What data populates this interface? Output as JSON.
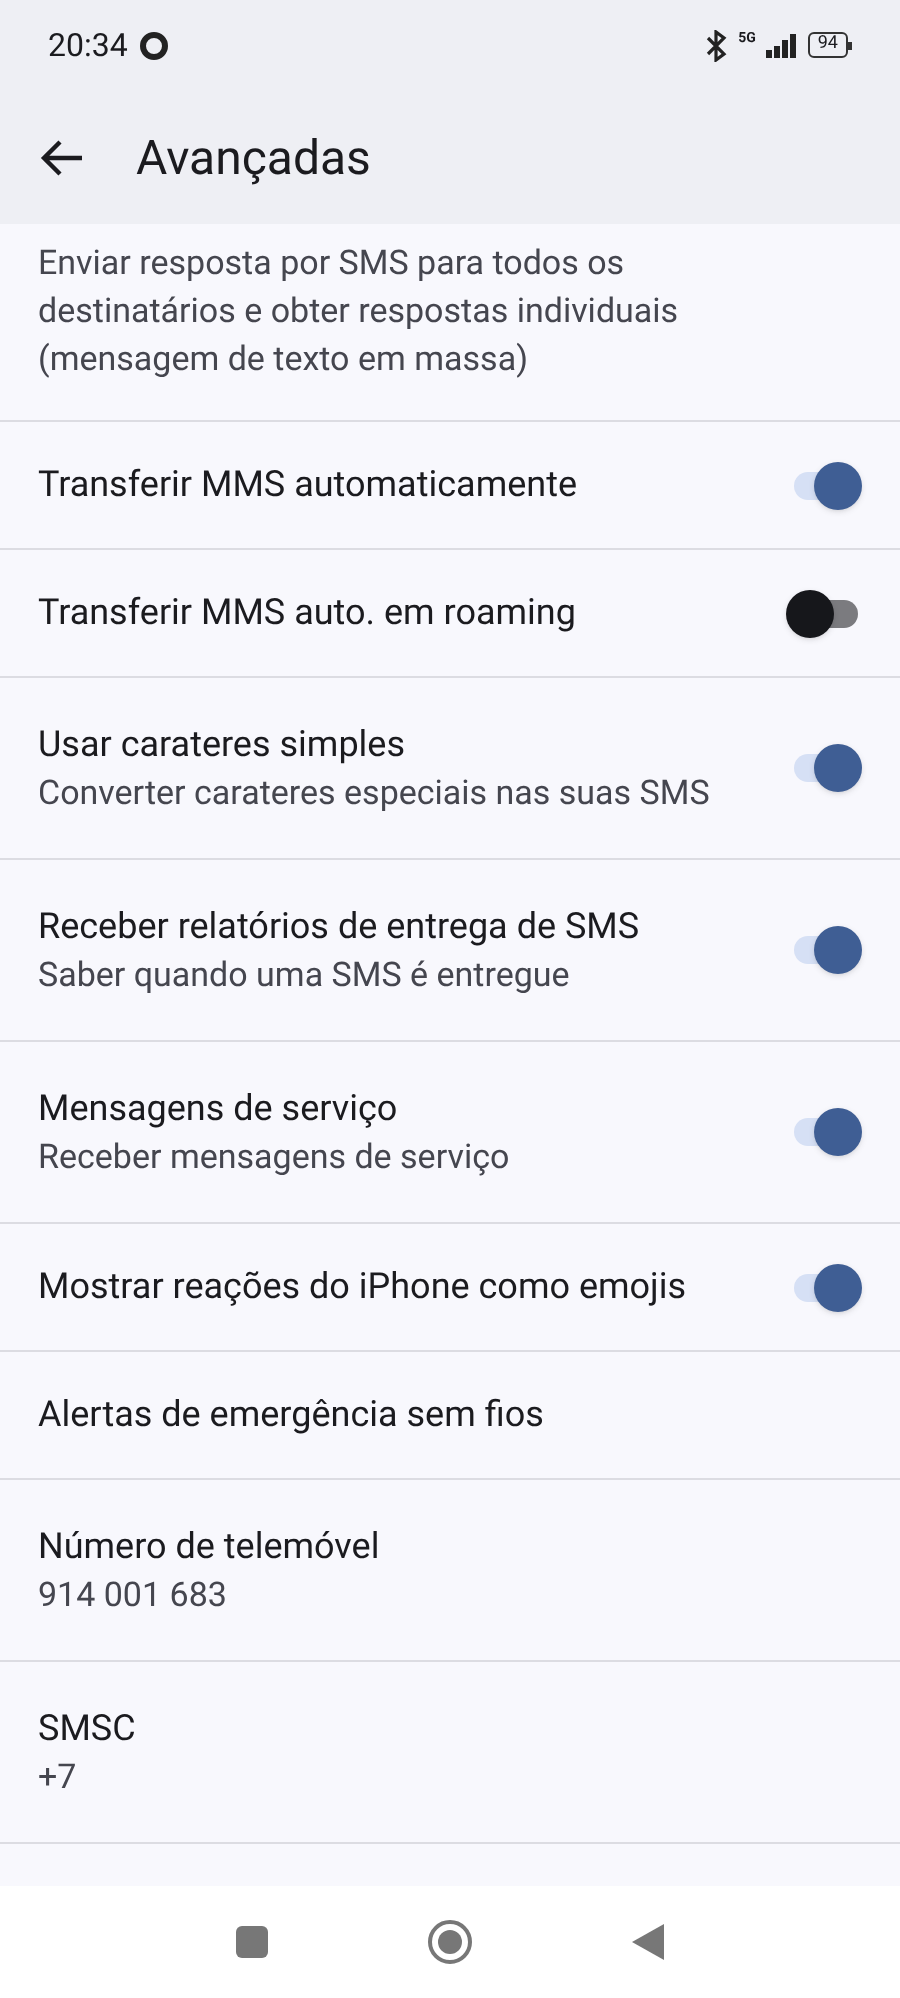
{
  "status_bar": {
    "time": "20:34",
    "network": "5G",
    "battery": "94"
  },
  "header": {
    "title": "Avançadas"
  },
  "partial_item": {
    "description": "Enviar resposta por SMS para todos os destinatários e obter respostas individuais (mensagem de texto em massa)"
  },
  "settings": [
    {
      "kind": "toggle",
      "title": "Transferir MMS automaticamente",
      "on": true
    },
    {
      "kind": "toggle",
      "title": "Transferir MMS auto. em roaming",
      "on": false
    },
    {
      "kind": "toggle",
      "title": "Usar carateres simples",
      "description": "Converter carateres especiais nas suas SMS",
      "on": true
    },
    {
      "kind": "toggle",
      "title": "Receber relatórios de entrega de SMS",
      "description": "Saber quando uma SMS é entregue",
      "on": true
    },
    {
      "kind": "toggle",
      "title": "Mensagens de serviço",
      "description": "Receber mensagens de serviço",
      "on": true
    },
    {
      "kind": "toggle",
      "title": "Mostrar reações do iPhone como emojis",
      "on": true
    },
    {
      "kind": "text",
      "title": "Alertas de emergência sem fios"
    },
    {
      "kind": "text",
      "title": "Número de telemóvel",
      "description": "914 001 683"
    },
    {
      "kind": "text",
      "title": "SMSC",
      "description": "+7"
    }
  ]
}
